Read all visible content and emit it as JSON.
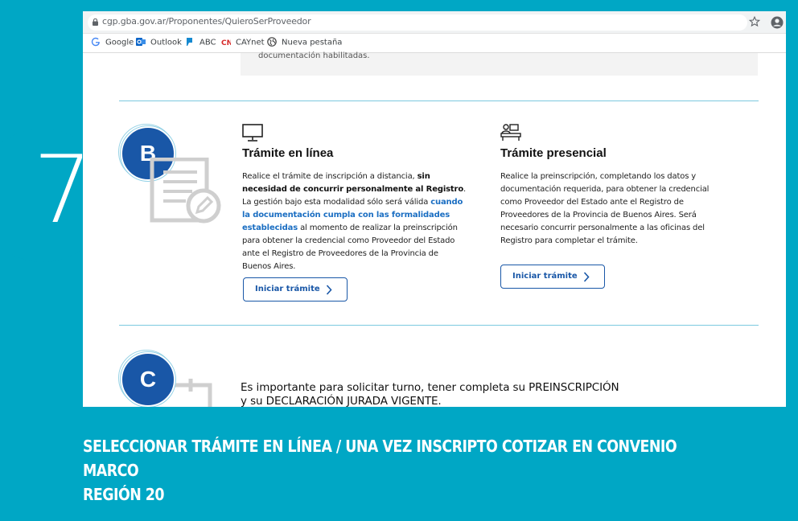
{
  "step": {
    "number": "7"
  },
  "browser": {
    "url": "cgp.gba.gov.ar/Proponentes/QuieroSerProveedor",
    "bookmarks": [
      {
        "label": "Google",
        "icon": "google-icon"
      },
      {
        "label": "Outlook",
        "icon": "outlook-icon"
      },
      {
        "label": "ABC",
        "icon": "abc-icon"
      },
      {
        "label": "CAYnet",
        "icon": "caynet-icon"
      },
      {
        "label": "Nueva pestaña",
        "icon": "globe-icon"
      }
    ]
  },
  "page": {
    "top_box_text": "documentación habilitadas.",
    "section_b": {
      "badge": "B",
      "online": {
        "title": "Trámite en línea",
        "body": [
          "Realice el trámite de inscripción a distancia, ",
          "sin necesidad de concurrir personalmente al Registro",
          ". La gestión bajo esta modalidad sólo será válida ",
          "cuando la documentación cumpla con las formalidades establecidas",
          " al momento de realizar la preinscripción para obtener la credencial como Proveedor del Estado ante el Registro de Proveedores de la Provincia de Buenos Aires."
        ],
        "button": "Iniciar trámite"
      },
      "presencial": {
        "title": "Trámite presencial",
        "body": "Realice la preinscripción, completando los datos y documentación requerida, para obtener la credencial como Proveedor del Estado ante el Registro de Proveedores de la Provincia de Buenos Aires. Será necesario concurrir personalmente a las oficinas del Registro para completar el trámite.",
        "button": "Iniciar trámite"
      }
    },
    "section_c": {
      "badge": "C",
      "text_line1": "Es importante para solicitar turno, tener completa su PREINSCRIPCIÓN",
      "text_line2": "y su DECLARACIÓN JURADA VIGENTE."
    }
  },
  "caption": {
    "line1": "SELECCIONAR TRÁMITE EN LÍNEA / UNA VEZ INSCRIPTO COTIZAR EN CONVENIO MARCO",
    "line2": "REGIÓN 20"
  },
  "colors": {
    "frame": "#00a7c5",
    "badge": "#1957a7",
    "link": "#1b6ec2",
    "divider": "#7cc9df"
  }
}
